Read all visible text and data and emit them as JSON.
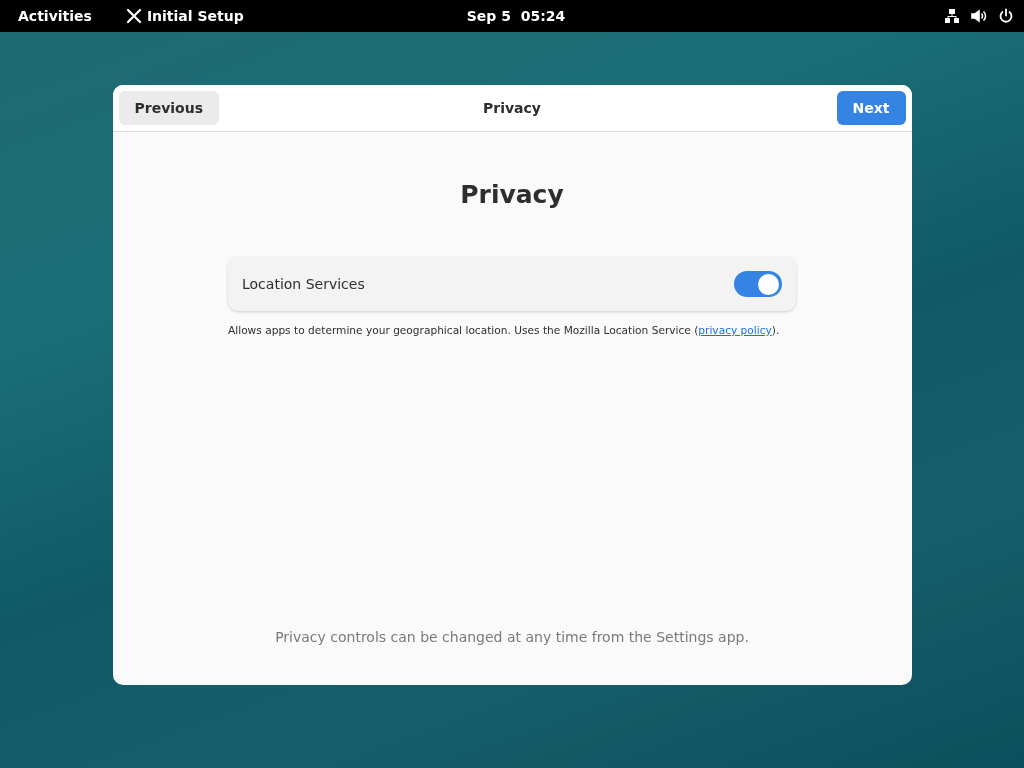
{
  "top_bar": {
    "activities": "Activities",
    "app_name": "Initial Setup",
    "clock": "Sep 5  05:24"
  },
  "dialog": {
    "header": {
      "previous": "Previous",
      "title": "Privacy",
      "next": "Next"
    },
    "heading": "Privacy",
    "settings": [
      {
        "label": "Location Services",
        "on": true
      }
    ],
    "description": {
      "before": "Allows apps to determine your geographical location. Uses the Mozilla Location Service (",
      "link": "privacy policy",
      "after": ")."
    },
    "footer": "Privacy controls can be changed at any time from the Settings app."
  }
}
